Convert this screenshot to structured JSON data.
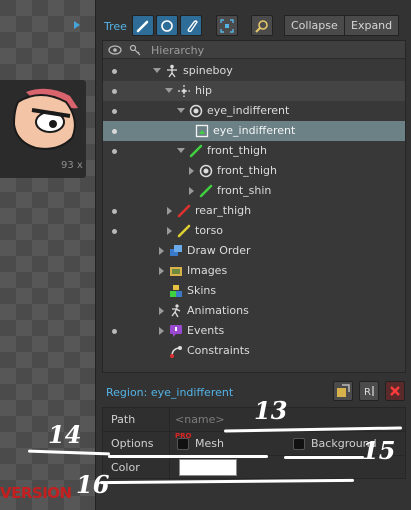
{
  "viewport": {
    "preview_size_text": "93 x",
    "version_text": "VERSION"
  },
  "toolbar": {
    "tree_label": "Tree",
    "collapse_label": "Collapse",
    "expand_label": "Expand"
  },
  "tree": {
    "header": "Hierarchy",
    "nodes": [
      {
        "label": "spineboy",
        "icon": "skeleton-icon"
      },
      {
        "label": "hip",
        "icon": "bone-icon"
      },
      {
        "label": "eye_indifferent",
        "icon": "slot-icon"
      },
      {
        "label": "eye_indifferent",
        "icon": "region-attachment-icon"
      },
      {
        "label": "front_thigh",
        "icon": "bone-icon"
      },
      {
        "label": "front_thigh",
        "icon": "slot-icon"
      },
      {
        "label": "front_shin",
        "icon": "bone-icon"
      },
      {
        "label": "rear_thigh",
        "icon": "bone-icon"
      },
      {
        "label": "torso",
        "icon": "bone-icon"
      },
      {
        "label": "Draw Order",
        "icon": "draw-order-icon"
      },
      {
        "label": "Images",
        "icon": "images-folder-icon"
      },
      {
        "label": "Skins",
        "icon": "skins-icon"
      },
      {
        "label": "Animations",
        "icon": "animations-icon"
      },
      {
        "label": "Events",
        "icon": "events-icon"
      },
      {
        "label": "Constraints",
        "icon": "constraints-icon"
      }
    ]
  },
  "region": {
    "title": "Region: eye_indifferent",
    "path_label": "Path",
    "path_placeholder": "<name>",
    "options_label": "Options",
    "pro_badge": "PRO",
    "mesh_label": "Mesh",
    "background_label": "Background",
    "color_label": "Color",
    "color_value": "#ffffff"
  },
  "annotations": {
    "a13": "13",
    "a14": "14",
    "a15": "15",
    "a16": "16"
  },
  "colors": {
    "accent": "#54b4e8",
    "selected_row": "#6b8186",
    "bone_green": "#3fcf3f",
    "bone_red": "#e03030",
    "bone_yellow": "#e0d030"
  }
}
